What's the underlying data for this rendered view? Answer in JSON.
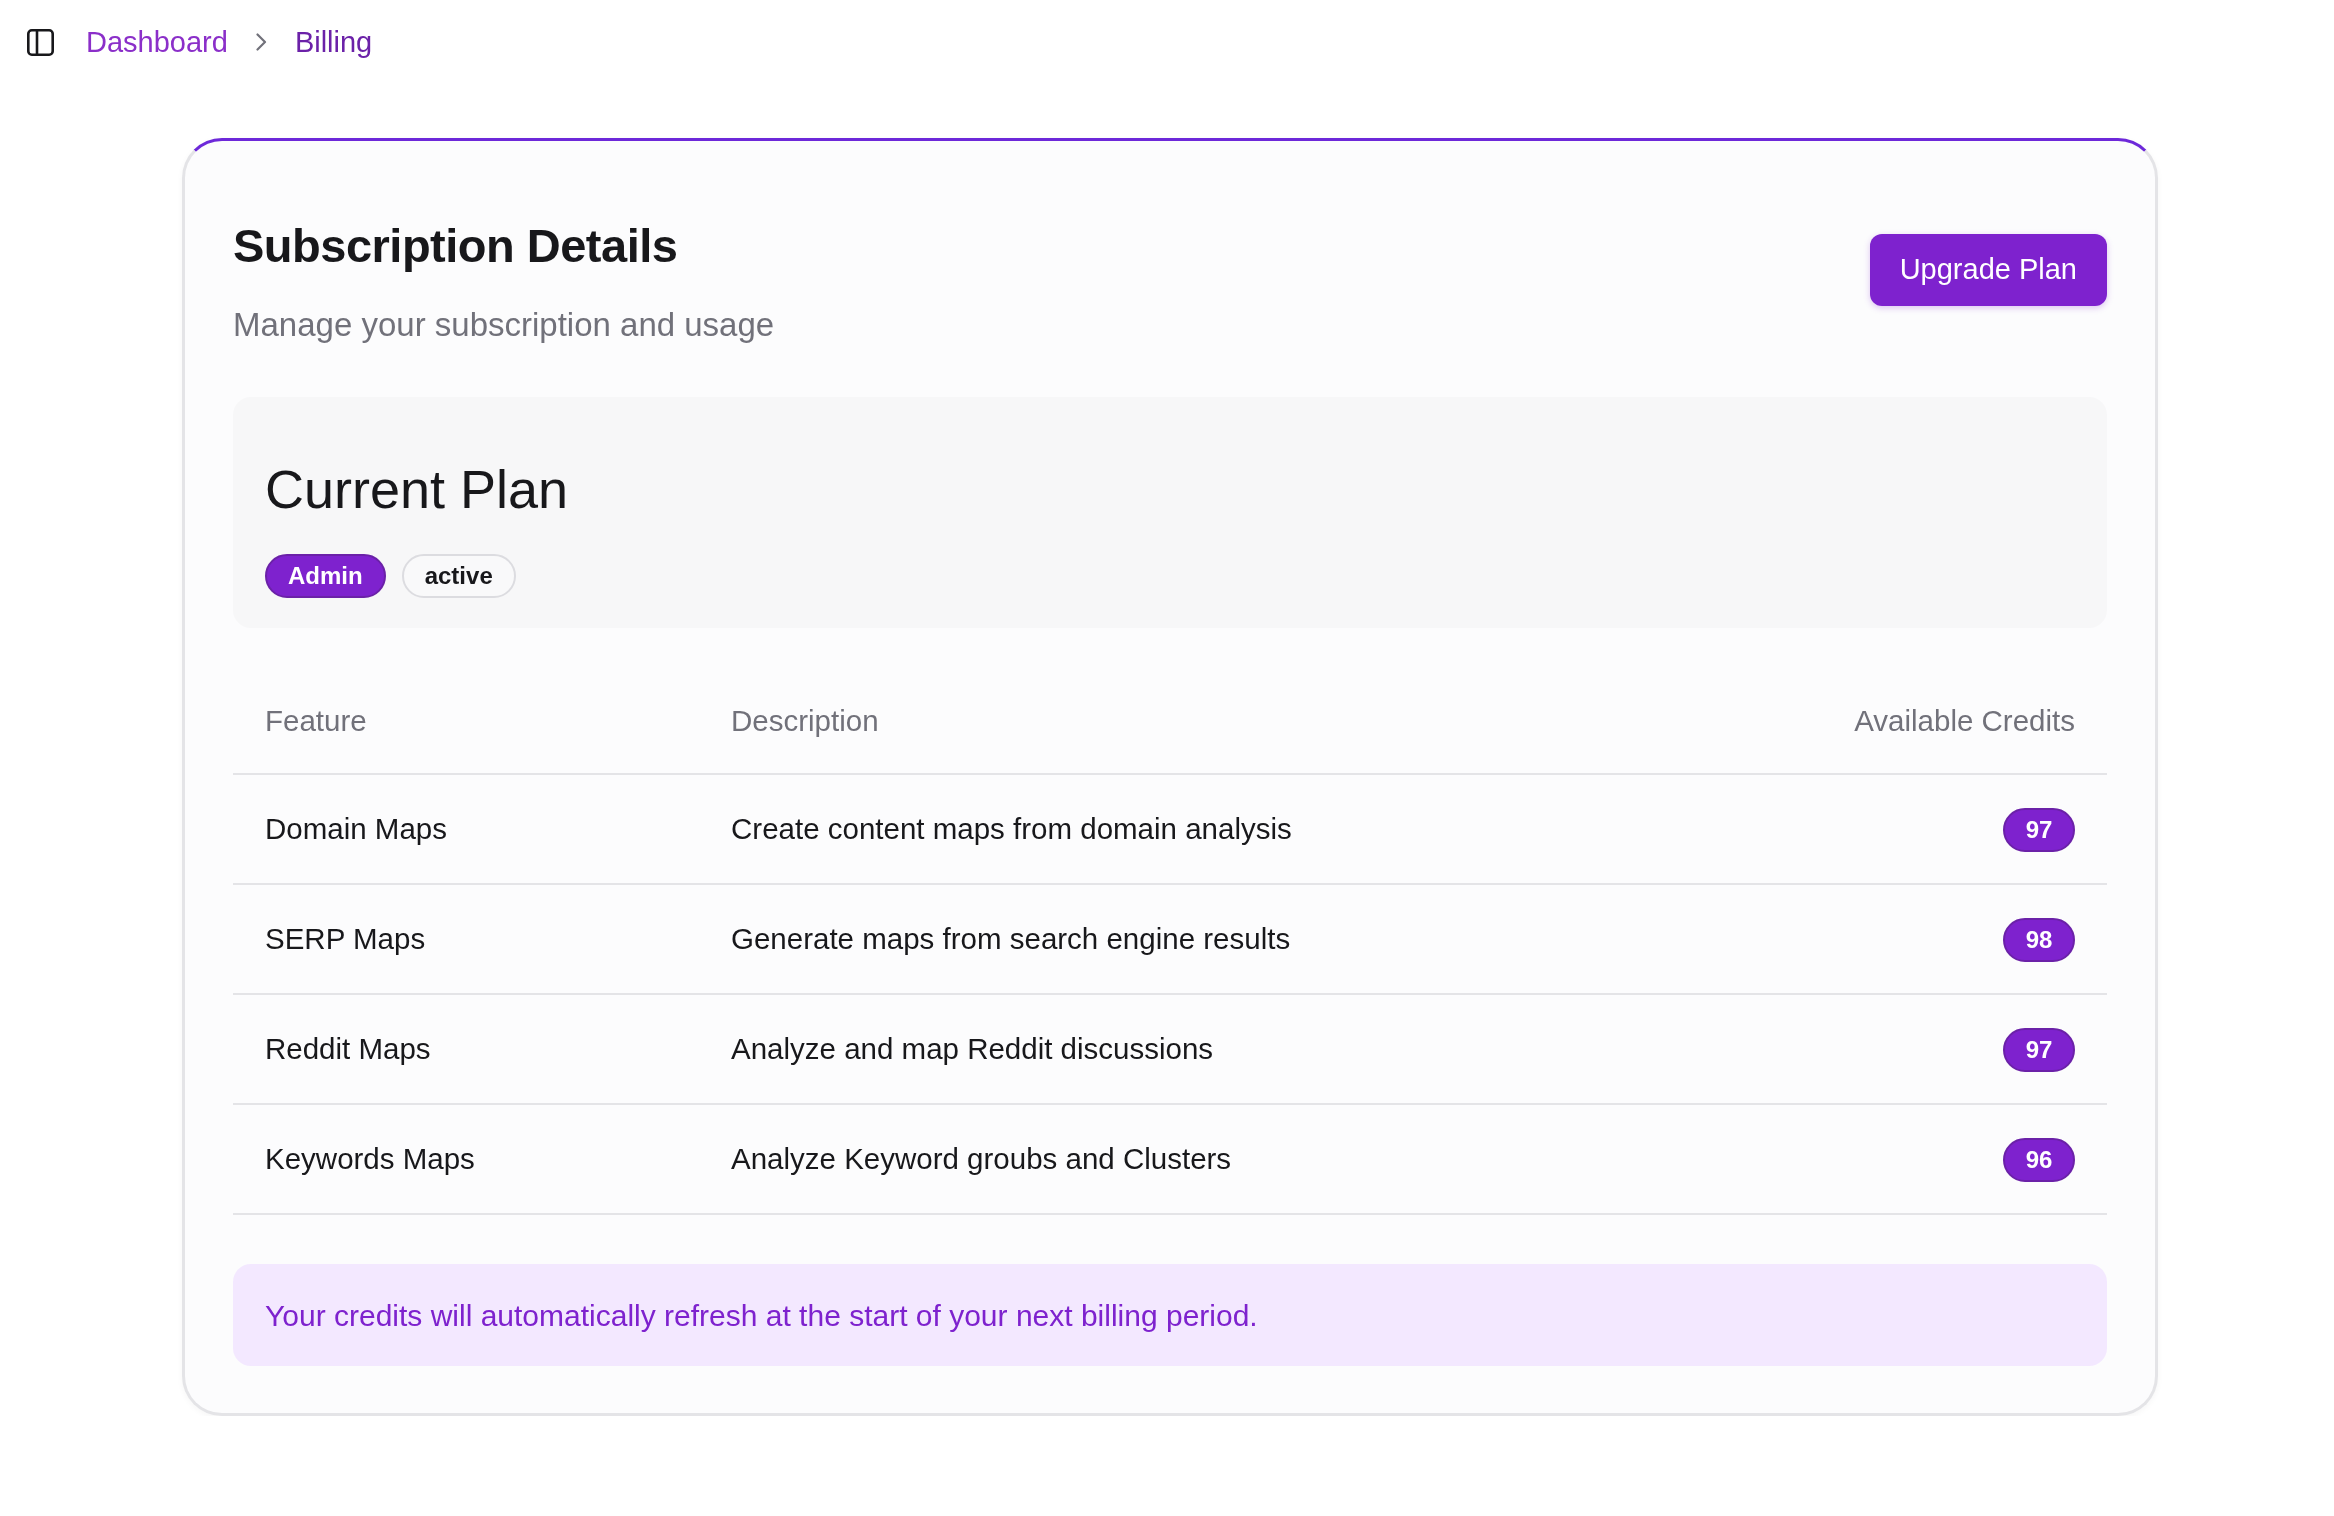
{
  "breadcrumb": [
    {
      "label": "Dashboard",
      "selected": false
    },
    {
      "label": "Billing",
      "selected": true
    }
  ],
  "header": {
    "title": "Subscription Details",
    "subtitle": "Manage your subscription and usage",
    "button": "Upgrade Plan"
  },
  "current_plan": {
    "title": "Current Plan",
    "badges": [
      {
        "label": "Admin",
        "kind": "filled"
      },
      {
        "label": "active",
        "kind": "outline"
      }
    ]
  },
  "table": {
    "columns": [
      "Feature",
      "Description",
      "Available Credits"
    ],
    "rows": [
      {
        "feature": "Domain Maps",
        "description": "Create content maps from domain analysis",
        "credits": "97"
      },
      {
        "feature": "SERP Maps",
        "description": "Generate maps from search engine results",
        "credits": "98"
      },
      {
        "feature": "Reddit Maps",
        "description": "Analyze and map Reddit discussions",
        "credits": "97"
      },
      {
        "feature": "Keywords Maps",
        "description": "Analyze Keyword groubs and Clusters",
        "credits": "96"
      }
    ]
  },
  "notice": "Your credits will automatically refresh at the start of your next billing period."
}
